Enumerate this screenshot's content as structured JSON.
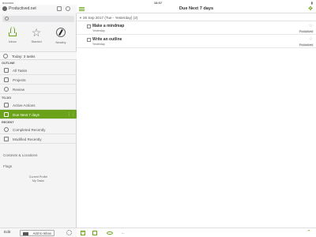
{
  "status": {
    "carrier": "docomo",
    "time": "18:07",
    "battery": "▮"
  },
  "sidebar": {
    "account_name": "Productived.net",
    "quick": [
      {
        "label": "Inbox",
        "icon": "inbox-icon"
      },
      {
        "label": "Starred",
        "icon": "star-icon"
      },
      {
        "label": "Nearby",
        "icon": "compass-icon"
      }
    ],
    "today_label": "Today: 3 tasks",
    "outline_header": "OUTLINE",
    "outline_items": [
      {
        "label": "All Tasks"
      },
      {
        "label": "Projects"
      },
      {
        "label": "Review"
      }
    ],
    "todo_header": "TO-DO",
    "todo_items": [
      {
        "label": "Active Actions"
      },
      {
        "label": "Due Next 7 days"
      }
    ],
    "recent_header": "RECENT",
    "recent_items": [
      {
        "label": "Completed Recently"
      },
      {
        "label": "Modified Recently"
      }
    ],
    "contexts_label": "Contexts & Locations",
    "flags_label": "Flags",
    "profile_title": "Current Profile",
    "profile_name": "My Tasks",
    "edit_label": "Edit",
    "add_inbox_label": "Add to Inbox"
  },
  "main": {
    "title": "Due Next 7 days",
    "group_label": "26 Sep 2017 (Tue - Yesterday) (2)",
    "tasks": [
      {
        "title": "Make  a mindmap",
        "due": "Yesterday",
        "context": "Productived"
      },
      {
        "title": "Write an outline",
        "due": "Yesterday",
        "context": "Productived"
      }
    ]
  }
}
